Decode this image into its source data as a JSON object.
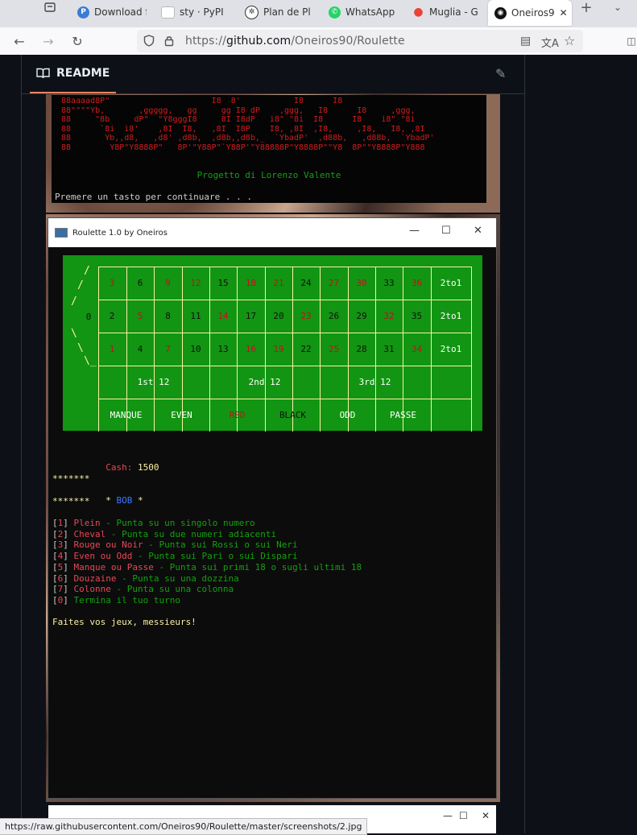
{
  "tabs": [
    {
      "label": "Download f",
      "favicon": "download-icon",
      "color": "#3a7bd5"
    },
    {
      "label": "sty · PyPI",
      "favicon": "page-icon",
      "color": "#cccccc"
    },
    {
      "label": "Plan de Pla",
      "favicon": "chatgpt-icon",
      "color": "#222222"
    },
    {
      "label": "WhatsApp",
      "favicon": "whatsapp-icon",
      "color": "#25d366"
    },
    {
      "label": "Muglia - Go",
      "favicon": "maps-pin-icon",
      "color": "#ea4335"
    },
    {
      "label": "Oneiros9",
      "favicon": "github-icon",
      "color": "#111111"
    }
  ],
  "url": {
    "prefix": "https://",
    "host": "github.com",
    "path": "/Oneiros90/Roulette"
  },
  "readme": {
    "label": "README"
  },
  "console1": {
    "ascii": " 88aaaad8P\"                     I8  8'           I8      I8\n 88\"\"\"\"Yb,       ,ggggg,   gg     gg I8 dP    ,ggg,   I8      I8     ,ggg,\n 88     \"8b     dP\"  \"Y8gggI8     8I I8dP   i8\" \"8i  I8      I8    i8\" \"8i\n 88      `8i  i8'    ,8I  I8,   ,8I  I8P    I8, ,8I  ,I8,     ,I8,   I8, ,8I\n 88       Yb,,d8,   ,d8' ,d8b,  ,d8b,,d8b,_  `YbadP'  ,d88b,   ,d88b,  `YbadP'\n 88        Y8P\"Y8888P\"   8P'\"Y88P\"`Y88P'\"Y88888P\"Y8888P\"\"Y8  8P\"\"Y8888P\"Y888",
    "credit": "Progetto di Lorenzo Valente",
    "press": "Premere un tasto per continuare . . ."
  },
  "window": {
    "title": "Roulette 1.0 by Oneiros",
    "minimize": "—",
    "maximize": "☐",
    "close": "✕"
  },
  "table": {
    "zero": "0",
    "rows": [
      [
        "3",
        "6",
        "9",
        "12",
        "15",
        "18",
        "21",
        "24",
        "27",
        "30",
        "33",
        "36",
        "2to1"
      ],
      [
        "2",
        "5",
        "8",
        "11",
        "14",
        "17",
        "20",
        "23",
        "26",
        "29",
        "32",
        "35",
        "2to1"
      ],
      [
        "1",
        "4",
        "7",
        "10",
        "13",
        "16",
        "19",
        "22",
        "25",
        "28",
        "31",
        "34",
        "2to1"
      ]
    ],
    "dozens": [
      "1st 12",
      "2nd 12",
      "3rd 12"
    ],
    "bets": [
      "MANQUE",
      "EVEN",
      "RED",
      "BLACK",
      "ODD",
      "PASSE"
    ]
  },
  "cash": {
    "label": "Cash:",
    "value": "1500"
  },
  "player": {
    "stars": "*******",
    "name": "BOB"
  },
  "menu": [
    {
      "key": "1",
      "name": "Plein",
      "desc": " - Punta su un singolo numero"
    },
    {
      "key": "2",
      "name": "Cheval",
      "desc": " - Punta su due numeri adiacenti"
    },
    {
      "key": "3",
      "name": "Rouge ou Noir",
      "desc": " - Punta sui Rossi o sui Neri"
    },
    {
      "key": "4",
      "name": "Even ou Odd",
      "desc": " - Punta sui Pari o sui Dispari"
    },
    {
      "key": "5",
      "name": "Manque ou Passe",
      "desc": " - Punta sui primi 18 o sugli ultimi 18"
    },
    {
      "key": "6",
      "name": "Douzaine",
      "desc": " - Punta su una dozzina"
    },
    {
      "key": "7",
      "name": "Colonne",
      "desc": " - Punta su una colonna"
    },
    {
      "key": "0",
      "name": "Termina il tuo turno",
      "desc": ""
    }
  ],
  "prompt": "Faites vos jeux, messieurs!",
  "window2": {
    "minimize": "—",
    "maximize": "☐",
    "close": "✕"
  },
  "status_url": "https://raw.githubusercontent.com/Oneiros90/Roulette/master/screenshots/2.jpg"
}
